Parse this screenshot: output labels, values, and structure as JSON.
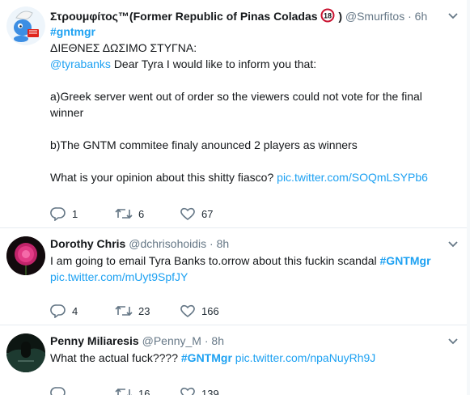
{
  "tweets": [
    {
      "display_name": "Στρουμφίτος™(Former Republic of Pinas Coladas",
      "badge": "18",
      "handle": "@Smurfitos",
      "time": "6h",
      "hashtag_line": "#gntmgr",
      "lines": [
        "ΔΙΕΘΝΕΣ ΔΩΣΙΜΟ ΣΤΥΓΝΑ:",
        "Dear Tyra I would like to inform you that:",
        "a)Greek server went out of order so the viewers could not vote for the final",
        "winner",
        "b)The GNTM commitee finaly anounced 2 players as winners",
        "What is your opinion about this shitty fiasco?"
      ],
      "mention": "@tyrabanks",
      "pic_link": "pic.twitter.com/SOQmLSYPb6",
      "replies": "1",
      "retweets": "6",
      "likes": "67"
    },
    {
      "display_name": "Dorothy Chris",
      "handle": "@dchrisohoidis",
      "time": "8h",
      "text": "I am going to email Tyra Banks to.orrow about this fuckin scandal",
      "hashtag": "#GNTMgr",
      "pic_link": "pic.twitter.com/mUyt9SpfJY",
      "replies": "4",
      "retweets": "23",
      "likes": "166"
    },
    {
      "display_name": "Penny Miliaresis",
      "handle": "@Penny_M",
      "time": "8h",
      "text": "What the actual fuck????",
      "hashtag": "#GNTMgr",
      "pic_link": "pic.twitter.com/npaNuyRh9J",
      "retweets": "16",
      "likes": "139"
    }
  ],
  "icons": {
    "reply": "reply-icon",
    "retweet": "retweet-icon",
    "like": "heart-icon",
    "more": "chevron-down-icon"
  },
  "colors": {
    "link": "#1da1f2",
    "muted": "#657786",
    "divider": "#e6ecf0"
  }
}
